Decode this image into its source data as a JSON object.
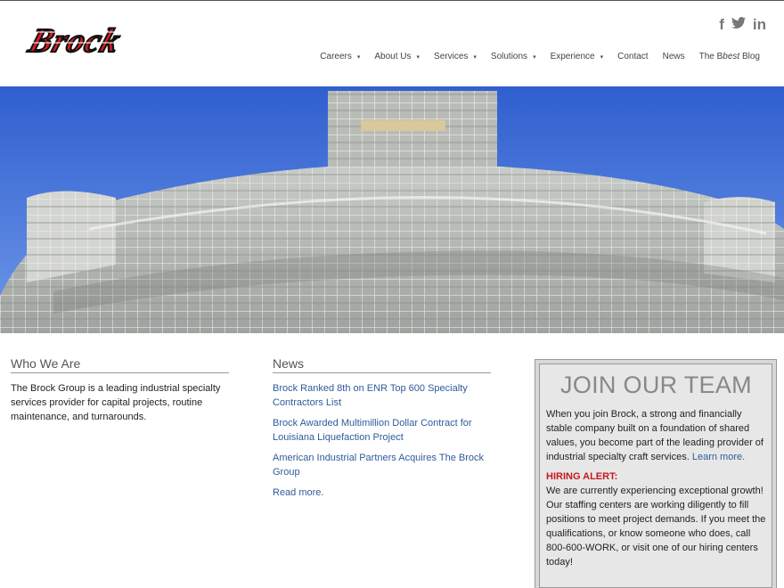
{
  "header": {
    "logo_text": "Brock",
    "social": [
      {
        "icon": "facebook-icon",
        "glyph": "f"
      },
      {
        "icon": "twitter-icon",
        "glyph": "t"
      },
      {
        "icon": "linkedin-icon",
        "glyph": "in"
      }
    ],
    "nav": [
      {
        "label": "Careers",
        "dropdown": true
      },
      {
        "label": "About Us",
        "dropdown": true
      },
      {
        "label": "Services",
        "dropdown": true
      },
      {
        "label": "Solutions",
        "dropdown": true
      },
      {
        "label": "Experience",
        "dropdown": true
      },
      {
        "label": "Contact",
        "dropdown": false
      },
      {
        "label": "News",
        "dropdown": false
      }
    ],
    "blog": {
      "prefix": "The B",
      "italic": "best",
      "suffix": " Blog"
    }
  },
  "who": {
    "title": "Who We Are",
    "text": "The Brock Group is a leading industrial specialty services provider for capital projects, routine maintenance, and turnarounds."
  },
  "news": {
    "title": "News",
    "items": [
      "Brock Ranked 8th on ENR Top 600 Specialty Contractors List",
      "Brock Awarded Multimillion Dollar Contract for Louisiana Liquefaction Project",
      "American Industrial Partners Acquires The Brock Group",
      "Read more."
    ]
  },
  "join": {
    "title": "JOIN OUR TEAM",
    "text": "When you join Brock, a strong and financially stable company built on a foundation of shared values, you become part of the leading provider of industrial specialty craft services.",
    "link": "Learn more.",
    "alert_label": "HIRING ALERT:",
    "alert_text": "We are currently experiencing exceptional growth! Our staffing centers are working diligently to fill positions to meet project demands. If you meet the qualifications, or know someone who does, call 800-600-WORK, or visit one of our hiring centers today!"
  },
  "colors": {
    "brand_red": "#c8161d",
    "link_blue": "#2f5b9a",
    "sky": "#3f6fd6"
  }
}
